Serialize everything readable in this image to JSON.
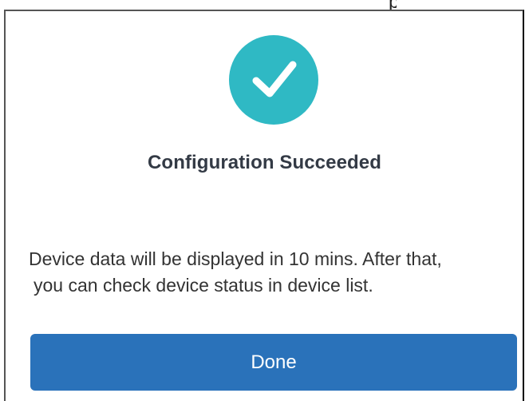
{
  "dialog": {
    "title": "Configuration Succeeded",
    "message_line1": "Device data will be displayed in 10 mins. After that,",
    "message_line2": "you can check device status in device list.",
    "done_label": "Done",
    "icon": "check-circle-icon",
    "top_glyph": "p"
  },
  "colors": {
    "accent_teal": "#2fb9c4",
    "button_blue": "#2a72ba",
    "title_text": "#333a45",
    "body_text": "#333333"
  }
}
